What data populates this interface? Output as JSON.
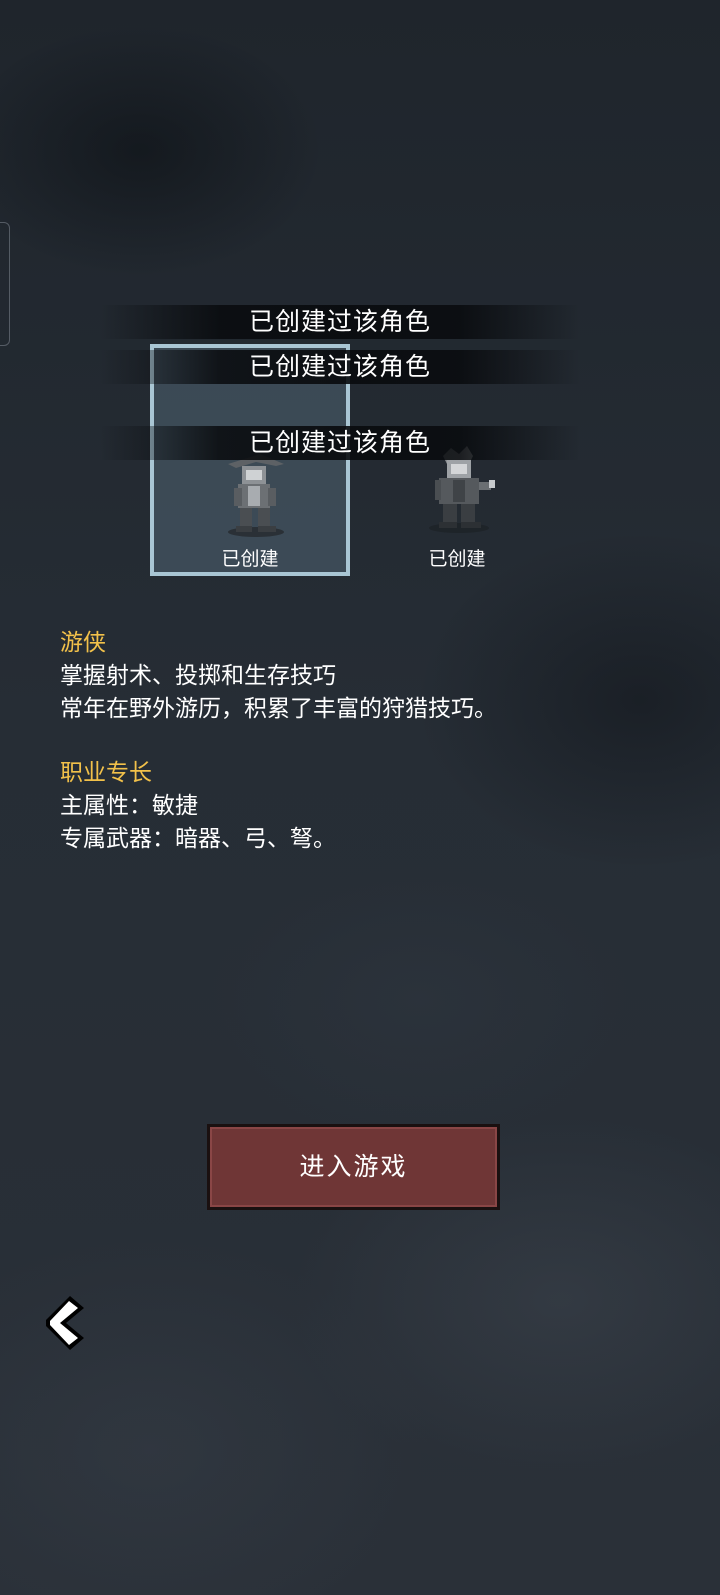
{
  "banners": [
    "已创建过该角色",
    "已创建过该角色",
    "已创建过该角色"
  ],
  "characters": [
    {
      "label": "已创建",
      "selected": true,
      "icon": "ranger-sprite-icon"
    },
    {
      "label": "已创建",
      "selected": false,
      "icon": "warrior-sprite-icon"
    }
  ],
  "class_info": {
    "name": "游侠",
    "desc_line1": "掌握射术、投掷和生存技巧",
    "desc_line2": "常年在野外游历，积累了丰富的狩猎技巧。"
  },
  "specialty": {
    "title": "职业专长",
    "main_attr": "主属性：敏捷",
    "weapons": "专属武器：暗器、弓、弩。"
  },
  "enter_button": "进入游戏",
  "back_icon": "chevron-left-icon",
  "colors": {
    "gold": "#f2c14a",
    "button": "#6f3636",
    "selected_border": "#a9c6d4"
  }
}
